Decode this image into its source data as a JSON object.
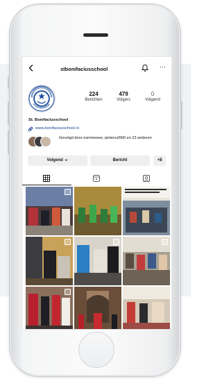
{
  "profile": {
    "username": "stbonifaciusschool",
    "name": "St. Bonifaciusschool",
    "website": "www.bonifaciusschool.nl",
    "followed_by": "Gevolgd door esmmeeee, pieterszl990 en 23 anderen",
    "avatar_text_top": "ST. BONIFACIUSSCHOOL",
    "avatar_text_bottom": "WASSENAAR"
  },
  "stats": [
    {
      "value": "224",
      "label": "Berichten"
    },
    {
      "value": "479",
      "label": "Volgers"
    },
    {
      "value": "0",
      "label": "Volgend"
    }
  ],
  "buttons": {
    "following": "Volgend",
    "message": "Bericht",
    "add_person": "+8"
  },
  "icons": {
    "back": "back-arrow-icon",
    "bell": "bell-icon",
    "more": "⋯",
    "link": "link-icon",
    "grid_tab": "grid-icon",
    "reels_tab": "reels-icon",
    "tagged_tab": "tagged-icon"
  },
  "colors": {
    "link": "#1b3f8f",
    "button_bg": "#efefef",
    "badge_blue": "#1d4e9e"
  }
}
